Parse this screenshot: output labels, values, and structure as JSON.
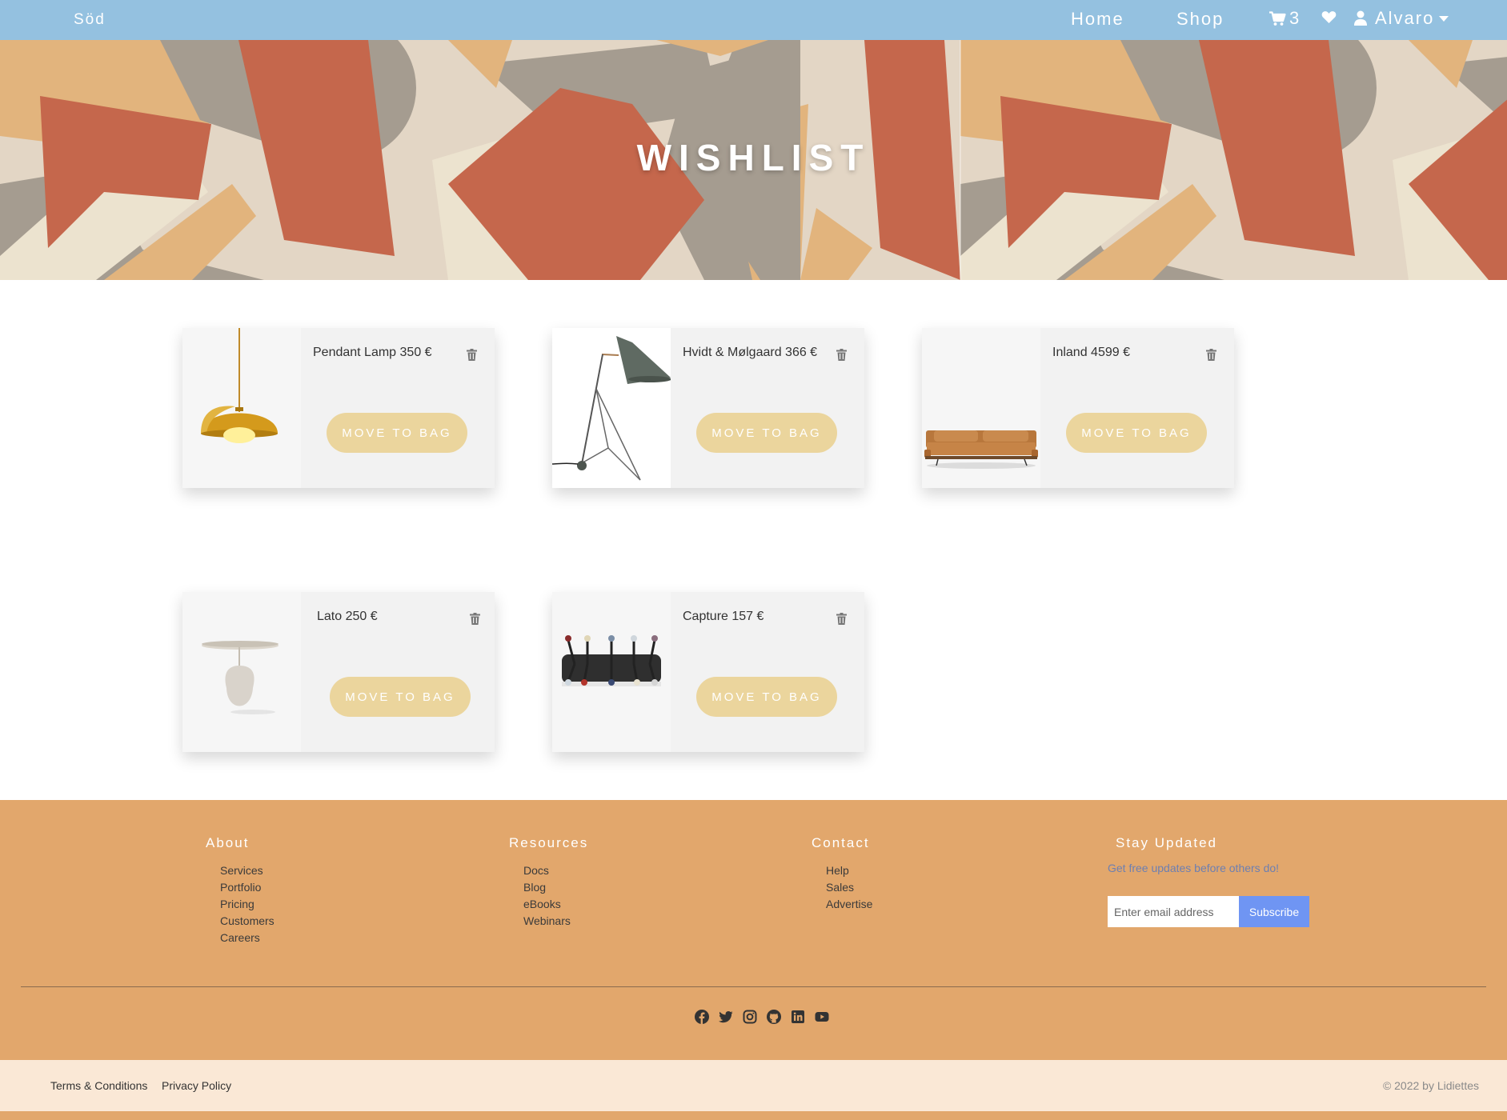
{
  "nav": {
    "brand": "Söd",
    "links": [
      "Home",
      "Shop"
    ],
    "cart_count": "3",
    "user_name": "Alvaro"
  },
  "hero": {
    "title": "WISHLIST"
  },
  "wishlist": {
    "button_label": "MOVE TO BAG",
    "items": [
      {
        "label": "Pendant Lamp 350 €",
        "image": "pendant-lamp-image"
      },
      {
        "label": "Hvidt & Mølgaard 366 €",
        "image": "floor-lamp-image"
      },
      {
        "label": "Inland 4599 €",
        "image": "sofa-image"
      },
      {
        "label": "Lato 250 €",
        "image": "side-table-image"
      },
      {
        "label": "Capture 157 €",
        "image": "coat-rack-image"
      }
    ]
  },
  "footer": {
    "about": {
      "title": "About",
      "links": [
        "Services",
        "Portfolio",
        "Pricing",
        "Customers",
        "Careers"
      ]
    },
    "resources": {
      "title": "Resources",
      "links": [
        "Docs",
        "Blog",
        "eBooks",
        "Webinars"
      ]
    },
    "contact": {
      "title": "Contact",
      "links": [
        "Help",
        "Sales",
        "Advertise"
      ]
    },
    "stay_updated": {
      "title": "Stay Updated",
      "text": "Get free updates before others do!",
      "email_placeholder": "Enter email address",
      "subscribe_label": "Subscribe"
    },
    "socials": [
      "facebook-icon",
      "twitter-icon",
      "instagram-icon",
      "github-icon",
      "linkedin-icon",
      "youtube-icon"
    ]
  },
  "bottom": {
    "terms": "Terms & Conditions",
    "privacy": "Privacy Policy",
    "copyright": "© 2022 by Lidiettes"
  },
  "colors": {
    "navbar": "#94c1e0",
    "move_button": "#ebd59d",
    "footer": "#e2a76c",
    "bottom_bar": "#fae8d6",
    "subscribe": "#6f95f3"
  }
}
